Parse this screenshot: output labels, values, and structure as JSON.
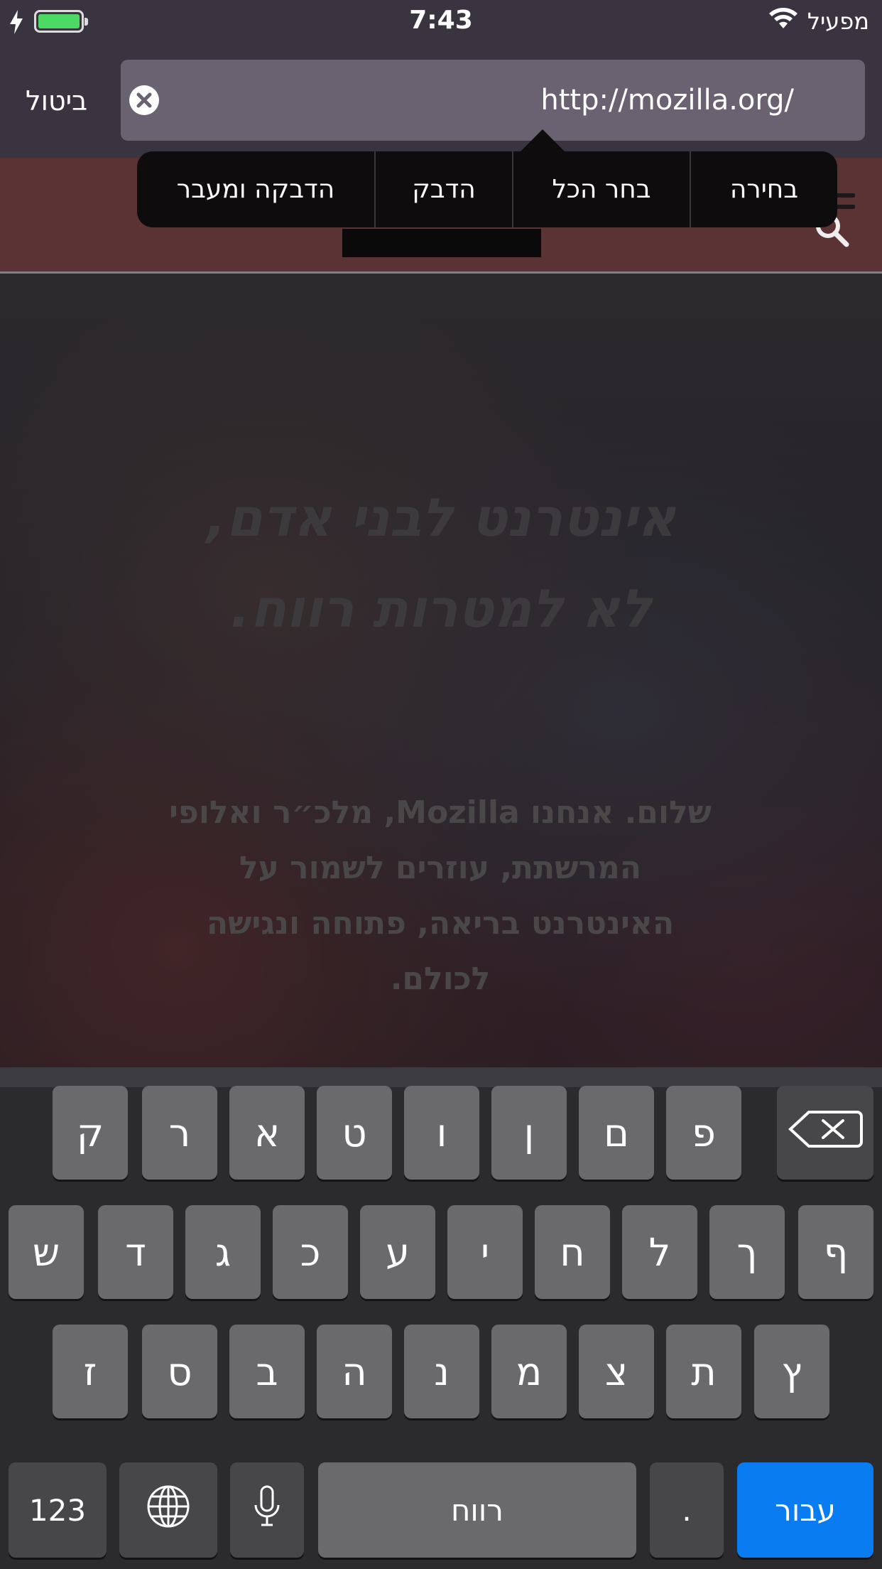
{
  "status_bar": {
    "time": "7:43",
    "carrier": "מפעיל"
  },
  "url_bar": {
    "cancel_label": "ביטול",
    "url": "http://mozilla.org/"
  },
  "context_menu": {
    "items": [
      "בחירה",
      "בחר הכל",
      "הדבק",
      "הדבקה ומעבר"
    ]
  },
  "hero": {
    "title_line1": "אינטרנט לבני אדם,",
    "title_line2": "לא למטרות רווח.",
    "text_line1": "שלום. אנחנו Mozilla, מלכ״ר ואלופי",
    "text_line2": "המרשתת, עוזרים לשמור על",
    "text_line3": "האינטרנט בריאה, פתוחה ונגישה",
    "text_line4": "לכולם."
  },
  "keyboard": {
    "row1": [
      "ק",
      "ר",
      "א",
      "ט",
      "ו",
      "ן",
      "ם",
      "פ"
    ],
    "row2": [
      "ש",
      "ד",
      "ג",
      "כ",
      "ע",
      "י",
      "ח",
      "ל",
      "ך",
      "ף"
    ],
    "row3": [
      "ז",
      "ס",
      "ב",
      "ה",
      "נ",
      "מ",
      "צ",
      "ת",
      "ץ"
    ],
    "numbers_label": "123",
    "space_label": "רווח",
    "period_label": ".",
    "go_label": "עבור"
  },
  "colors": {
    "go_key": "#0a7cf2",
    "battery": "#4cd964"
  },
  "icons": [
    "charging-bolt-icon",
    "battery-icon",
    "wifi-icon",
    "clear-text-icon",
    "search-icon",
    "menu-icon",
    "backspace-icon",
    "globe-icon",
    "microphone-icon"
  ]
}
